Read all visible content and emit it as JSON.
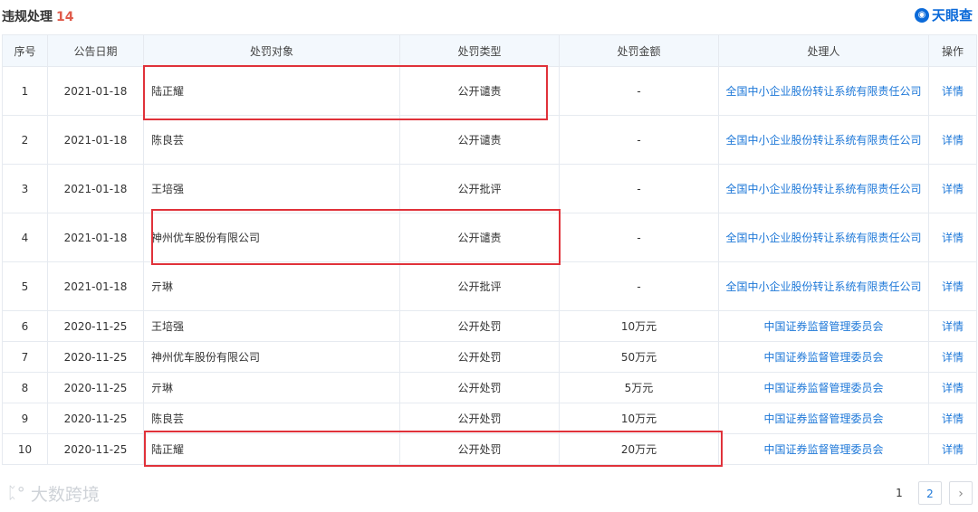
{
  "header": {
    "title": "违规处理",
    "count": "14",
    "brand": "天眼查"
  },
  "columns": [
    "序号",
    "公告日期",
    "处罚对象",
    "处罚类型",
    "处罚金额",
    "处理人",
    "操作"
  ],
  "rows": [
    {
      "no": "1",
      "date": "2021-01-18",
      "target": "陆正耀",
      "type": "公开谴责",
      "amount": "-",
      "handler": "全国中小企业股份转让系统有限责任公司",
      "op": "详情"
    },
    {
      "no": "2",
      "date": "2021-01-18",
      "target": "陈良芸",
      "type": "公开谴责",
      "amount": "-",
      "handler": "全国中小企业股份转让系统有限责任公司",
      "op": "详情"
    },
    {
      "no": "3",
      "date": "2021-01-18",
      "target": "王培强",
      "type": "公开批评",
      "amount": "-",
      "handler": "全国中小企业股份转让系统有限责任公司",
      "op": "详情"
    },
    {
      "no": "4",
      "date": "2021-01-18",
      "target": "神州优车股份有限公司",
      "type": "公开谴责",
      "amount": "-",
      "handler": "全国中小企业股份转让系统有限责任公司",
      "op": "详情"
    },
    {
      "no": "5",
      "date": "2021-01-18",
      "target": "亓琳",
      "type": "公开批评",
      "amount": "-",
      "handler": "全国中小企业股份转让系统有限责任公司",
      "op": "详情"
    },
    {
      "no": "6",
      "date": "2020-11-25",
      "target": "王培强",
      "type": "公开处罚",
      "amount": "10万元",
      "handler": "中国证券监督管理委员会",
      "op": "详情"
    },
    {
      "no": "7",
      "date": "2020-11-25",
      "target": "神州优车股份有限公司",
      "type": "公开处罚",
      "amount": "50万元",
      "handler": "中国证券监督管理委员会",
      "op": "详情"
    },
    {
      "no": "8",
      "date": "2020-11-25",
      "target": "亓琳",
      "type": "公开处罚",
      "amount": "5万元",
      "handler": "中国证券监督管理委员会",
      "op": "详情"
    },
    {
      "no": "9",
      "date": "2020-11-25",
      "target": "陈良芸",
      "type": "公开处罚",
      "amount": "10万元",
      "handler": "中国证券监督管理委员会",
      "op": "详情"
    },
    {
      "no": "10",
      "date": "2020-11-25",
      "target": "陆正耀",
      "type": "公开处罚",
      "amount": "20万元",
      "handler": "中国证券监督管理委员会",
      "op": "详情"
    }
  ],
  "pagination": {
    "pages": [
      "1",
      "2"
    ],
    "next": "›"
  },
  "watermark": "大数跨境",
  "colors": {
    "link": "#1e78d8",
    "count": "#e05b4b",
    "highlight": "#e0323a",
    "header_bg": "#f3f8fd"
  }
}
